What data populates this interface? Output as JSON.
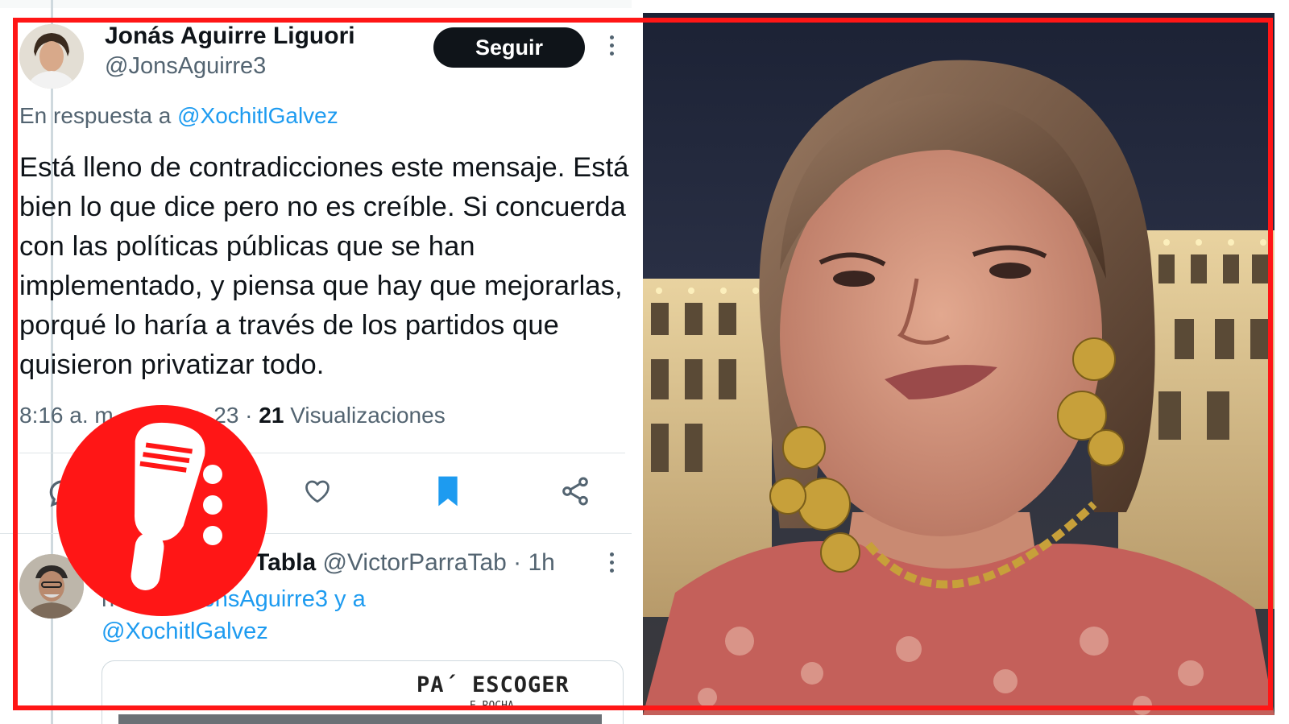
{
  "tweet": {
    "author_name": "Jonás Aguirre Liguori",
    "author_handle": "@JonsAguirre3",
    "follow_label": "Seguir",
    "reply_prefix": "En respuesta a ",
    "reply_to": "@XochitlGalvez",
    "text": "Está lleno de contradicciones este mensaje. Está bien lo que dice pero no es creíble. Si concuerda con las políticas públicas que se han implementado, y piensa que hay que mejorarlas, porqué lo haría a través de los partidos que quisieron privatizar todo.",
    "time": "8:16 a. m. · 27 jun. 23",
    "separator": " · ",
    "views_count": "21",
    "views_label": " Visualizaciones"
  },
  "reply": {
    "name_visible": "Tabla",
    "handle": "@VictorParraTab",
    "time": "· 1h",
    "prefix_visible": "ndo a ",
    "mention_1": "@JonsAguirre3",
    "joiner": " y a",
    "mention_2": "@XochitlGalvez",
    "media_title": "PA´ ESCOGER",
    "media_credit": "E.ROCHA"
  },
  "icons": {
    "reply": "reply-icon",
    "like": "heart-icon",
    "bookmark": "bookmark-icon",
    "share": "share-icon",
    "more": "more-options-icon",
    "overlay": "microphone-logo"
  },
  "colors": {
    "accent": "#1d9bf0",
    "frame": "#ff1616",
    "follow_bg": "#0f1419",
    "muted_text": "#536471"
  }
}
